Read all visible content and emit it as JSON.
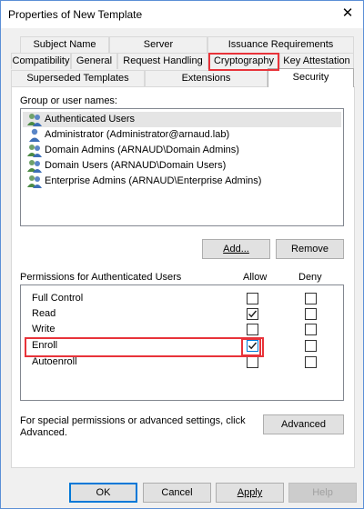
{
  "window": {
    "title": "Properties of New Template",
    "close_glyph": "✕"
  },
  "tabs": {
    "row1": [
      "Subject Name",
      "Server",
      "Issuance Requirements"
    ],
    "row2": [
      "Compatibility",
      "General",
      "Request Handling",
      "Cryptography",
      "Key Attestation"
    ],
    "row3": [
      "Superseded Templates",
      "Extensions",
      "Security"
    ],
    "active": "Security",
    "highlighted": "Cryptography"
  },
  "groups": {
    "label": "Group or user names:",
    "items": [
      "Authenticated Users",
      "Administrator (Administrator@arnaud.lab)",
      "Domain Admins (ARNAUD\\Domain Admins)",
      "Domain Users (ARNAUD\\Domain Users)",
      "Enterprise Admins (ARNAUD\\Enterprise Admins)"
    ],
    "selected_index": 0,
    "add_label": "Add...",
    "remove_label": "Remove"
  },
  "permissions": {
    "label": "Permissions for Authenticated Users",
    "allow_header": "Allow",
    "deny_header": "Deny",
    "rows": [
      {
        "name": "Full Control",
        "allow": false,
        "deny": false
      },
      {
        "name": "Read",
        "allow": true,
        "deny": false
      },
      {
        "name": "Write",
        "allow": false,
        "deny": false
      },
      {
        "name": "Enroll",
        "allow": true,
        "deny": false
      },
      {
        "name": "Autoenroll",
        "allow": false,
        "deny": false
      }
    ],
    "highlighted_row": "Enroll"
  },
  "advanced": {
    "note_line1": "For special permissions or advanced settings, click",
    "note_line2": "Advanced.",
    "button_label": "Advanced"
  },
  "footer": {
    "ok": "OK",
    "cancel": "Cancel",
    "apply": "Apply",
    "help": "Help"
  },
  "colors": {
    "highlight": "#e8333a",
    "accent": "#0078d7"
  }
}
